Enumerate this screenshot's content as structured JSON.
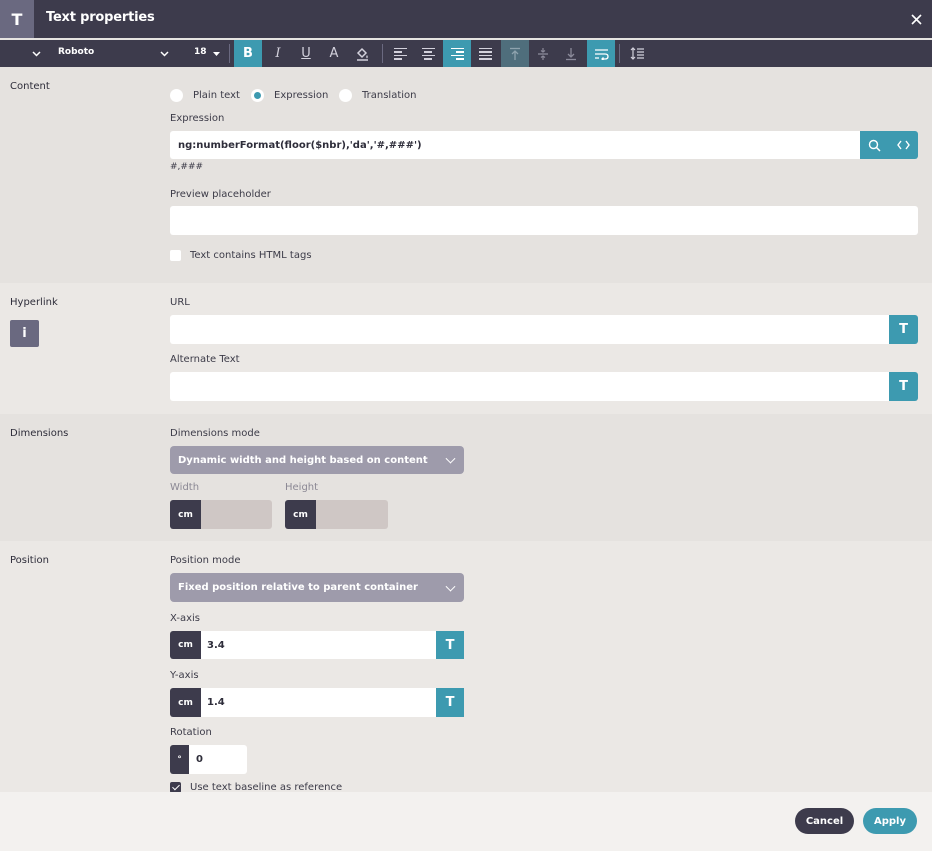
{
  "window": {
    "title": "Text properties",
    "icon_letter": "T"
  },
  "toolbar": {
    "font": "Roboto",
    "font_size": "18",
    "bold_label": "B",
    "italic_label": "I",
    "underline_label": "U",
    "color_label": "A"
  },
  "content": {
    "section_label": "Content",
    "radios": [
      "Plain text",
      "Expression",
      "Translation"
    ],
    "selected_radio": "Expression",
    "expression_label": "Expression",
    "expression_value": "ng:numberFormat(floor($nbr),'da','#,###')",
    "expression_hint": "#,###",
    "preview_label": "Preview placeholder",
    "preview_value": "",
    "html_tags_label": "Text contains HTML tags",
    "html_tags_checked": false
  },
  "hyperlink": {
    "section_label": "Hyperlink",
    "url_label": "URL",
    "url_value": "",
    "alt_label": "Alternate Text",
    "alt_value": "",
    "translate_glyph": "T",
    "info_glyph": "i"
  },
  "dimensions": {
    "section_label": "Dimensions",
    "mode_label": "Dimensions mode",
    "mode_value": "Dynamic width and height based on content",
    "width_label": "Width",
    "height_label": "Height",
    "unit": "cm"
  },
  "position": {
    "section_label": "Position",
    "mode_label": "Position mode",
    "mode_value": "Fixed position relative to parent container",
    "x_label": "X-axis",
    "x_value": "3.4",
    "y_label": "Y-axis",
    "y_value": "1.4",
    "unit": "cm",
    "rotation_label": "Rotation",
    "rotation_unit": "°",
    "rotation_value": "0",
    "baseline_label": "Use text baseline as reference",
    "baseline_checked": true
  },
  "footer": {
    "cancel_label": "Cancel",
    "apply_label": "Apply"
  },
  "colors": {
    "dark": "#3d3b4c",
    "accent": "#3d9ab0",
    "select": "#9e9bab",
    "cancel": "#3d3b4c",
    "apply": "#3d9ab0"
  }
}
